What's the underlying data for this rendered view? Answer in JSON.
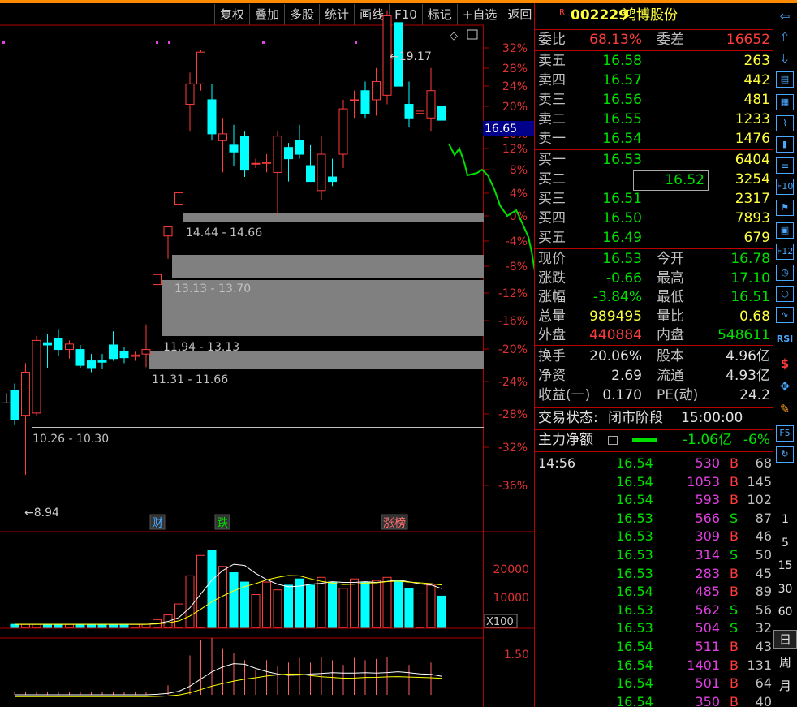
{
  "toolbar": [
    "复权",
    "叠加",
    "多股",
    "统计",
    "画线",
    "F10",
    "标记",
    "+自选",
    "返回"
  ],
  "chart": {
    "price_axis_labels": [
      "32%",
      "28%",
      "24%",
      "20%",
      "16%",
      "12%",
      "8%",
      "4%",
      "0%",
      "-4%",
      "-8%",
      "-12%",
      "-16%",
      "-20%",
      "-24%",
      "-28%",
      "-32%",
      "-36%"
    ],
    "current_price_tag": "16.65",
    "high_marker": "19.17",
    "low_marker": "8.94",
    "gap_labels": [
      "14.44 - 14.66",
      "13.13 - 13.70",
      "11.94 - 13.13",
      "11.31 - 11.66",
      "10.26 - 10.30"
    ],
    "event_badges": [
      {
        "text": "财",
        "color": "#4aa8ff"
      },
      {
        "text": "跌",
        "color": "#00e000"
      },
      {
        "text": "涨榜",
        "color": "#ff7070"
      }
    ],
    "volume_axis_labels": [
      "20000",
      "10000"
    ],
    "volume_unit": "X100",
    "indicator_axis_label": "1.50"
  },
  "chart_data": {
    "type": "candlestick",
    "candles": [
      {
        "o": 10.8,
        "h": 10.95,
        "l": 10.05,
        "c": 10.15
      },
      {
        "o": 10.25,
        "h": 11.4,
        "l": 8.94,
        "c": 11.2
      },
      {
        "o": 10.3,
        "h": 12.0,
        "l": 10.25,
        "c": 11.9
      },
      {
        "o": 11.85,
        "h": 12.05,
        "l": 11.3,
        "c": 11.8
      },
      {
        "o": 11.95,
        "h": 12.15,
        "l": 11.55,
        "c": 11.7
      },
      {
        "o": 11.7,
        "h": 11.9,
        "l": 11.5,
        "c": 11.82
      },
      {
        "o": 11.7,
        "h": 11.8,
        "l": 11.3,
        "c": 11.35
      },
      {
        "o": 11.45,
        "h": 11.6,
        "l": 11.2,
        "c": 11.3
      },
      {
        "o": 11.45,
        "h": 11.6,
        "l": 11.28,
        "c": 11.42
      },
      {
        "o": 11.8,
        "h": 12.1,
        "l": 11.45,
        "c": 11.5
      },
      {
        "o": 11.65,
        "h": 11.75,
        "l": 11.4,
        "c": 11.52
      },
      {
        "o": 11.55,
        "h": 11.65,
        "l": 11.45,
        "c": 11.58
      },
      {
        "o": 11.6,
        "h": 12.25,
        "l": 11.31,
        "c": 11.7
      },
      {
        "o": 13.13,
        "h": 13.35,
        "l": 12.95,
        "c": 13.35
      },
      {
        "o": 14.2,
        "h": 14.4,
        "l": 13.7,
        "c": 14.4
      },
      {
        "o": 14.9,
        "h": 15.3,
        "l": 14.25,
        "c": 15.15
      },
      {
        "o": 17.1,
        "h": 17.8,
        "l": 16.5,
        "c": 17.55
      },
      {
        "o": 17.55,
        "h": 18.3,
        "l": 17.4,
        "c": 18.25
      },
      {
        "o": 17.2,
        "h": 17.55,
        "l": 16.3,
        "c": 16.45
      },
      {
        "o": 16.3,
        "h": 16.8,
        "l": 15.6,
        "c": 16.45
      },
      {
        "o": 16.2,
        "h": 16.65,
        "l": 15.75,
        "c": 16.05
      },
      {
        "o": 16.4,
        "h": 16.5,
        "l": 15.5,
        "c": 15.65
      },
      {
        "o": 15.8,
        "h": 15.9,
        "l": 15.7,
        "c": 15.8
      },
      {
        "o": 15.8,
        "h": 16.0,
        "l": 15.6,
        "c": 15.82
      },
      {
        "o": 15.6,
        "h": 16.5,
        "l": 14.66,
        "c": 16.4
      },
      {
        "o": 16.15,
        "h": 16.25,
        "l": 15.4,
        "c": 15.9
      },
      {
        "o": 16.3,
        "h": 16.65,
        "l": 15.9,
        "c": 16.0
      },
      {
        "o": 15.75,
        "h": 16.2,
        "l": 15.4,
        "c": 15.4
      },
      {
        "o": 15.2,
        "h": 16.4,
        "l": 15.0,
        "c": 16.0
      },
      {
        "o": 15.5,
        "h": 15.9,
        "l": 15.3,
        "c": 15.4
      },
      {
        "o": 16.0,
        "h": 17.2,
        "l": 15.7,
        "c": 17.0
      },
      {
        "o": 17.2,
        "h": 17.4,
        "l": 16.8,
        "c": 17.2
      },
      {
        "o": 17.4,
        "h": 17.6,
        "l": 16.8,
        "c": 16.9
      },
      {
        "o": 17.2,
        "h": 17.9,
        "l": 16.85,
        "c": 17.6
      },
      {
        "o": 17.3,
        "h": 19.17,
        "l": 17.1,
        "c": 19.05
      },
      {
        "o": 18.9,
        "h": 19.0,
        "l": 17.4,
        "c": 17.5
      },
      {
        "o": 17.1,
        "h": 17.6,
        "l": 16.6,
        "c": 16.8
      },
      {
        "o": 16.9,
        "h": 17.2,
        "l": 16.55,
        "c": 16.95
      },
      {
        "o": 16.8,
        "h": 17.9,
        "l": 16.5,
        "c": 17.4
      },
      {
        "o": 17.05,
        "h": 17.2,
        "l": 16.7,
        "c": 16.75
      }
    ],
    "volume_x100": [
      1000,
      1000,
      1000,
      1000,
      1000,
      1000,
      1000,
      1000,
      1000,
      1000,
      1000,
      1000,
      1000,
      2500,
      4000,
      7500,
      16500,
      23000,
      24500,
      19500,
      17500,
      14500,
      10500,
      14500,
      12000,
      13500,
      15500,
      13500,
      16000,
      14500,
      12500,
      15500,
      14500,
      15000,
      16000,
      15000,
      12500,
      11000,
      13500,
      10000
    ],
    "volume_ylim": [
      0,
      28000
    ],
    "price_ref": 14.66
  },
  "quote": {
    "code": "002229",
    "name": "鸿博股份",
    "weibi": {
      "label": "委比",
      "value": "68.13%",
      "label2": "委差",
      "value2": "16652"
    },
    "sells": [
      {
        "label": "卖五",
        "price": "16.58",
        "vol": "263"
      },
      {
        "label": "卖四",
        "price": "16.57",
        "vol": "442"
      },
      {
        "label": "卖三",
        "price": "16.56",
        "vol": "481"
      },
      {
        "label": "卖二",
        "price": "16.55",
        "vol": "1233"
      },
      {
        "label": "卖一",
        "price": "16.54",
        "vol": "1476"
      }
    ],
    "buys": [
      {
        "label": "买一",
        "price": "16.53",
        "vol": "6404"
      },
      {
        "label": "买二",
        "price": "16.52",
        "vol": "3254"
      },
      {
        "label": "买三",
        "price": "16.51",
        "vol": "2317"
      },
      {
        "label": "买四",
        "price": "16.50",
        "vol": "7893"
      },
      {
        "label": "买五",
        "price": "16.49",
        "vol": "679"
      }
    ],
    "stats": [
      {
        "l1": "现价",
        "v1": "16.53",
        "c1": "grn",
        "l2": "今开",
        "v2": "16.78",
        "c2": "grn"
      },
      {
        "l1": "涨跌",
        "v1": "-0.66",
        "c1": "grn",
        "l2": "最高",
        "v2": "17.10",
        "c2": "grn"
      },
      {
        "l1": "涨幅",
        "v1": "-3.84%",
        "c1": "grn",
        "l2": "最低",
        "v2": "16.51",
        "c2": "grn"
      },
      {
        "l1": "总量",
        "v1": "989495",
        "c1": "yel",
        "l2": "量比",
        "v2": "0.68",
        "c2": "yel"
      },
      {
        "l1": "外盘",
        "v1": "440884",
        "c1": "red",
        "l2": "内盘",
        "v2": "548611",
        "c2": "grn"
      }
    ],
    "stats2": [
      {
        "l1": "换手",
        "v1": "20.06%",
        "l2": "股本",
        "v2": "4.96亿"
      },
      {
        "l1": "净资",
        "v1": "2.69",
        "l2": "流通",
        "v2": "4.93亿"
      },
      {
        "l1": "收益(一)",
        "v1": "0.170",
        "l2": "PE(动)",
        "v2": "24.2"
      }
    ],
    "status_label": "交易状态:",
    "status_value": "闭市阶段",
    "status_time": "15:00:00",
    "main_flow_label": "主力净额",
    "main_flow_value": "-1.06亿",
    "main_flow_pct": "-6%"
  },
  "ticks": [
    {
      "time": "14:56",
      "price": "16.54",
      "vol": "530",
      "bs": "B",
      "n": "68"
    },
    {
      "time": "",
      "price": "16.54",
      "vol": "1053",
      "bs": "B",
      "n": "145"
    },
    {
      "time": "",
      "price": "16.54",
      "vol": "593",
      "bs": "B",
      "n": "102"
    },
    {
      "time": "",
      "price": "16.53",
      "vol": "566",
      "bs": "S",
      "n": "87"
    },
    {
      "time": "",
      "price": "16.53",
      "vol": "309",
      "bs": "B",
      "n": "46"
    },
    {
      "time": "",
      "price": "16.53",
      "vol": "314",
      "bs": "S",
      "n": "50"
    },
    {
      "time": "",
      "price": "16.53",
      "vol": "283",
      "bs": "B",
      "n": "45"
    },
    {
      "time": "",
      "price": "16.54",
      "vol": "485",
      "bs": "B",
      "n": "89"
    },
    {
      "time": "",
      "price": "16.53",
      "vol": "562",
      "bs": "S",
      "n": "56"
    },
    {
      "time": "",
      "price": "16.53",
      "vol": "504",
      "bs": "S",
      "n": "32"
    },
    {
      "time": "",
      "price": "16.54",
      "vol": "511",
      "bs": "B",
      "n": "43"
    },
    {
      "time": "",
      "price": "16.54",
      "vol": "1401",
      "bs": "B",
      "n": "131"
    },
    {
      "time": "",
      "price": "16.54",
      "vol": "501",
      "bs": "B",
      "n": "64"
    },
    {
      "time": "",
      "price": "16.54",
      "vol": "350",
      "bs": "B",
      "n": "40"
    }
  ],
  "side_icons": [
    "left-arrow-icon",
    "up-arrow-icon",
    "down-arrow-icon",
    "news-icon",
    "grid-icon",
    "line-chart-icon",
    "candle-icon",
    "list-icon",
    "f10-icon",
    "flag-icon",
    "info-icon",
    "f12-icon",
    "clock-icon",
    "circle-icon",
    "wave-icon",
    "rsi-icon",
    "dollar-icon",
    "move-icon",
    "pencil-icon",
    "f5-icon",
    "refresh-icon"
  ],
  "side_text": {
    "rsi": "RSI",
    "f10": "F10",
    "f12": "F12",
    "f5": "F5"
  },
  "period_nums": [
    "1",
    "5",
    "15",
    "30",
    "60"
  ],
  "period_tabs": [
    "日",
    "周",
    "月"
  ],
  "colors": {
    "up": "#ff3c3c",
    "down": "#00ffff",
    "grid": "#b00000",
    "gap": "#808080",
    "ma_white": "#ffffff",
    "ma_yellow": "#ffff00"
  }
}
